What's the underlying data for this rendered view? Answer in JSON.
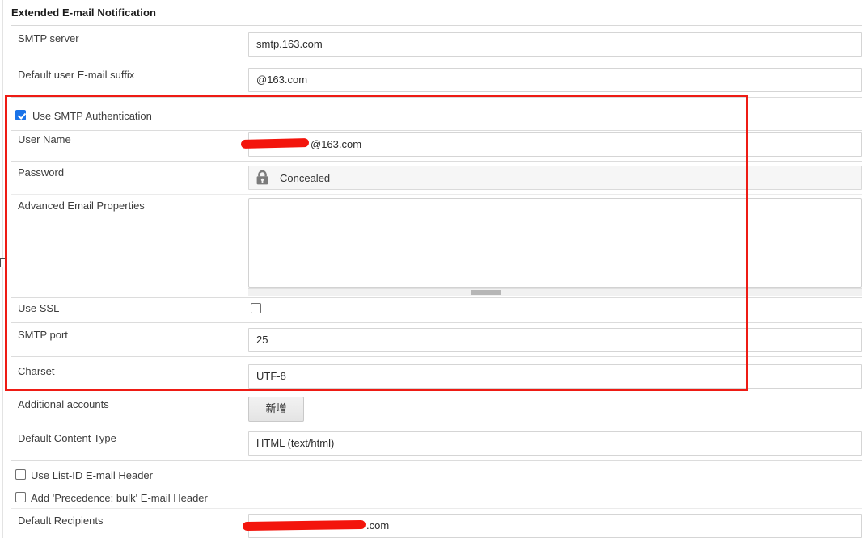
{
  "section": {
    "title": "Extended E-mail Notification"
  },
  "rows": {
    "smtp_server": {
      "label": "SMTP server",
      "value": "smtp.163.com"
    },
    "email_suffix": {
      "label": "Default user E-mail suffix",
      "value": "@163.com"
    },
    "use_smtp_auth": {
      "label": "Use SMTP Authentication",
      "checked": true
    },
    "user_name": {
      "label": "User Name",
      "value": "@163.com"
    },
    "password": {
      "label": "Password",
      "value": "Concealed",
      "icon": "lock-icon"
    },
    "advanced_props": {
      "label": "Advanced Email Properties",
      "value": ""
    },
    "use_ssl": {
      "label": "Use SSL",
      "checked": false
    },
    "smtp_port": {
      "label": "SMTP port",
      "value": "25"
    },
    "charset": {
      "label": "Charset",
      "value": "UTF-8"
    },
    "additional_accounts": {
      "label": "Additional accounts",
      "button_label": "新增"
    },
    "content_type": {
      "label": "Default Content Type",
      "value": "HTML (text/html)"
    },
    "list_id_header": {
      "label": "Use List-ID E-mail Header",
      "checked": false
    },
    "precedence_header": {
      "label": "Add 'Precedence: bulk' E-mail Header",
      "checked": false
    },
    "default_recipients": {
      "label": "Default Recipients",
      "value": ".com"
    }
  },
  "annotation": {
    "highlight_color": "#ee1b14",
    "redaction_color": "#f3150c"
  }
}
